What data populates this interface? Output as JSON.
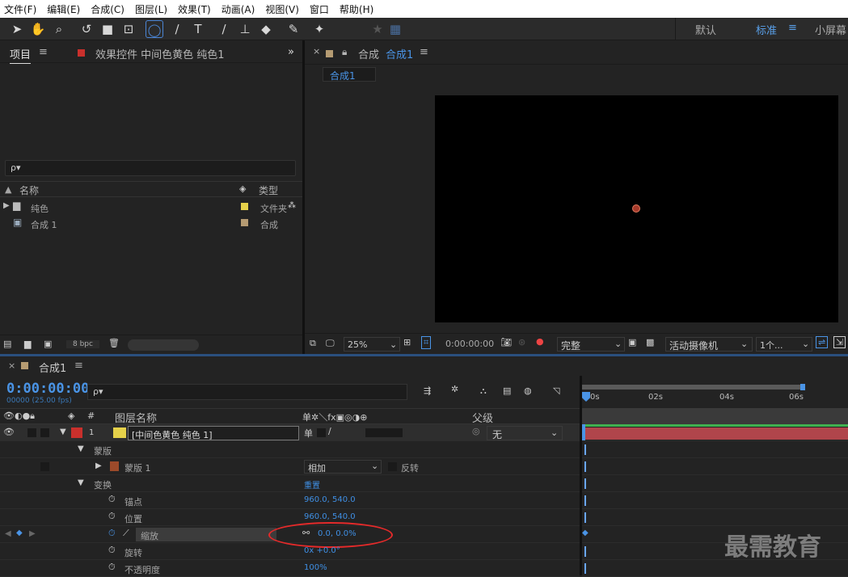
{
  "menu": [
    "文件(F)",
    "编辑(E)",
    "合成(C)",
    "图层(L)",
    "效果(T)",
    "动画(A)",
    "视图(V)",
    "窗口",
    "帮助(H)"
  ],
  "workspaces": {
    "default": "默认",
    "standard": "标准",
    "small": "小屏幕",
    "menu_glyph": "≡"
  },
  "project": {
    "tab_project": "项目",
    "tab_effects": "效果控件 中间色黄色 纯色1",
    "search_placeholder": "ρ▾",
    "col_name": "名称",
    "col_type": "类型",
    "items": [
      {
        "name": "纯色",
        "type": "文件夹",
        "color": "#e5d14a"
      },
      {
        "name": "合成 1",
        "type": "合成",
        "color": "#b59b72"
      }
    ],
    "bpc": "8 bpc"
  },
  "viewer": {
    "tab": "合成",
    "comp_name": "合成1",
    "sub_tab": "合成1",
    "zoom": "25%",
    "timecode": "0:00:00:00",
    "quality": "完整",
    "camera": "活动摄像机",
    "views": "1个..."
  },
  "timeline": {
    "tab": "合成1",
    "timecode": "0:00:00:00",
    "frames": "00000 (25.00 fps)",
    "search_placeholder": "ρ▾",
    "col_layer": "图层名称",
    "col_switches": "单✲＼fx▣◎◑⊕",
    "col_parent": "父级",
    "ruler": [
      "0s",
      "02s",
      "04s",
      "06s"
    ],
    "layer": {
      "num": "1",
      "name": "[中间色黄色 纯色 1]",
      "parent": "无",
      "color": "#e5d14a"
    },
    "rows": [
      {
        "label": "蒙版"
      },
      {
        "label": "蒙版 1",
        "mode": "相加",
        "invert": "反转"
      },
      {
        "label": "变换",
        "value": "重置"
      },
      {
        "label": "锚点",
        "value": "960.0, 540.0"
      },
      {
        "label": "位置",
        "value": "960.0, 540.0"
      },
      {
        "label": "缩放",
        "value": "0.0, 0.0%"
      },
      {
        "label": "旋转",
        "value": "0x +0.0°"
      },
      {
        "label": "不透明度",
        "value": "100%"
      }
    ]
  },
  "watermark": "最需教育"
}
